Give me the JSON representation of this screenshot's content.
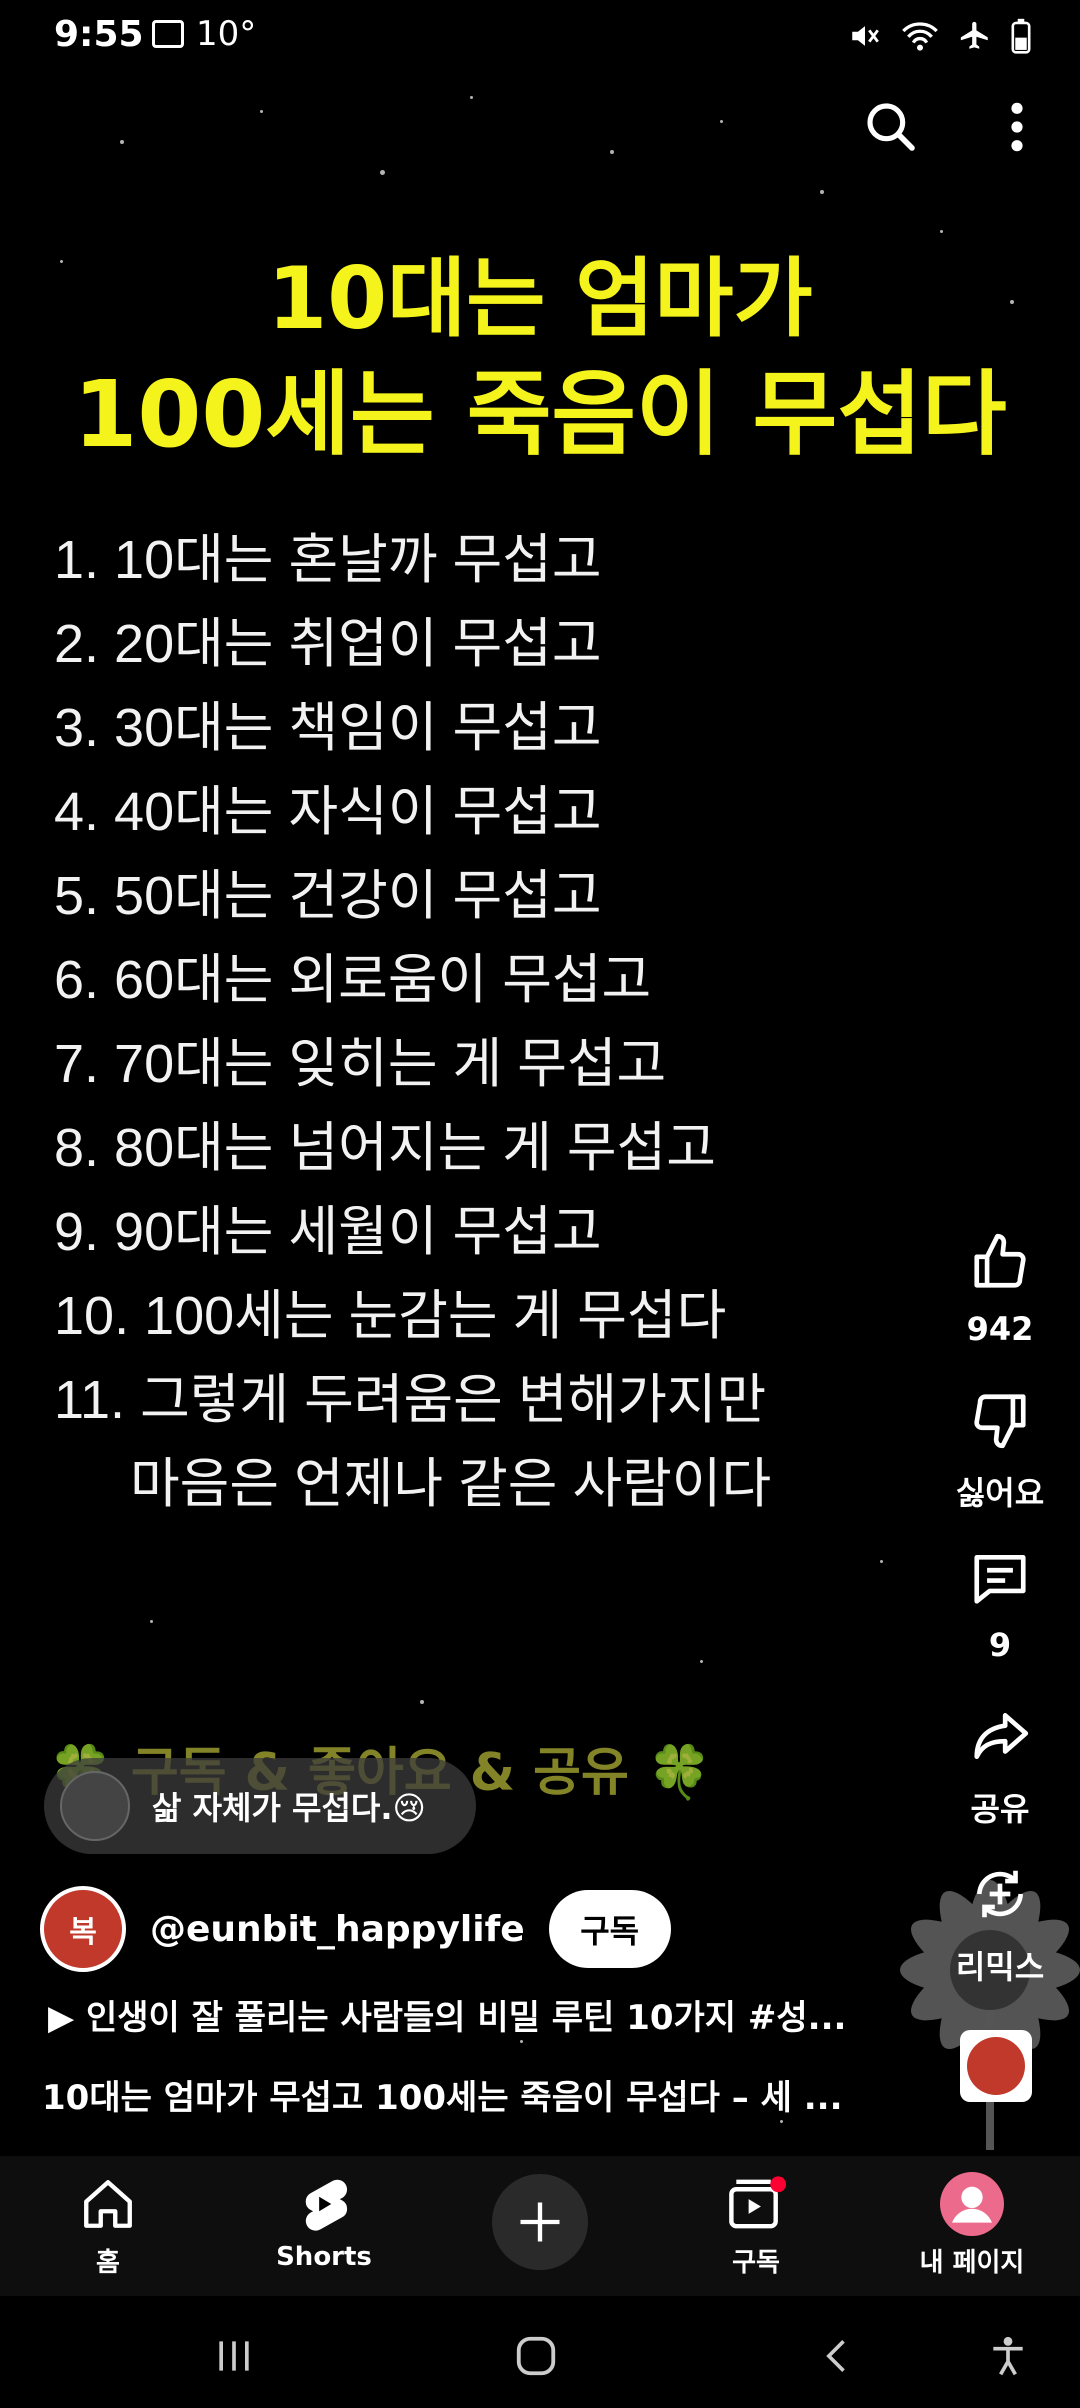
{
  "status_bar": {
    "time": "9:55",
    "temperature": "10°",
    "icons": [
      "gallery-icon",
      "mute-icon",
      "wifi-icon",
      "airplane-icon",
      "battery-icon"
    ]
  },
  "top_actions": {
    "search_icon": "search-icon",
    "more_icon": "more-vert-icon"
  },
  "video": {
    "title_line1": "10대는 엄마가",
    "title_line2": "100세는 죽음이 무섭다",
    "list": [
      "1. 10대는 혼날까 무섭고",
      "2. 20대는 취업이 무섭고",
      "3. 30대는 책임이 무섭고",
      "4. 40대는 자식이 무섭고",
      "5. 50대는 건강이 무섭고",
      "6. 60대는 외로움이 무섭고",
      "7. 70대는 잊히는 게 무섭고",
      "8. 80대는 넘어지는 게 무섭고",
      "9. 90대는 세월이 무섭고",
      "10. 100세는 눈감는 게 무섭다",
      "11. 그렇게 두려움은 변해가지만",
      "마음은 언제나 같은 사람이다"
    ],
    "subscribe_banner": "🍀 구독 & 좋아요 & 공유 🍀",
    "title_color": "#f4f31c"
  },
  "actions": {
    "like_count": "942",
    "dislike_label": "싫어요",
    "comment_count": "9",
    "share_label": "공유",
    "remix_label": "리믹스"
  },
  "comment_chip": {
    "text": "삶 자체가 무섭다.😢"
  },
  "channel": {
    "logo_text": "복",
    "handle": "@eunbit_happylife",
    "subscribe_label": "구독"
  },
  "related_link": "▶  인생이 잘 풀리는 사람들의 비밀 루틴 10가지 #성...",
  "description": "10대는 엄마가 무섭고 100세는 죽음이 무섭다 – 세 ...",
  "bottom_nav": {
    "home": "홈",
    "shorts": "Shorts",
    "subscriptions": "구독",
    "my_page": "내 페이지",
    "accent": "#ff0033"
  }
}
